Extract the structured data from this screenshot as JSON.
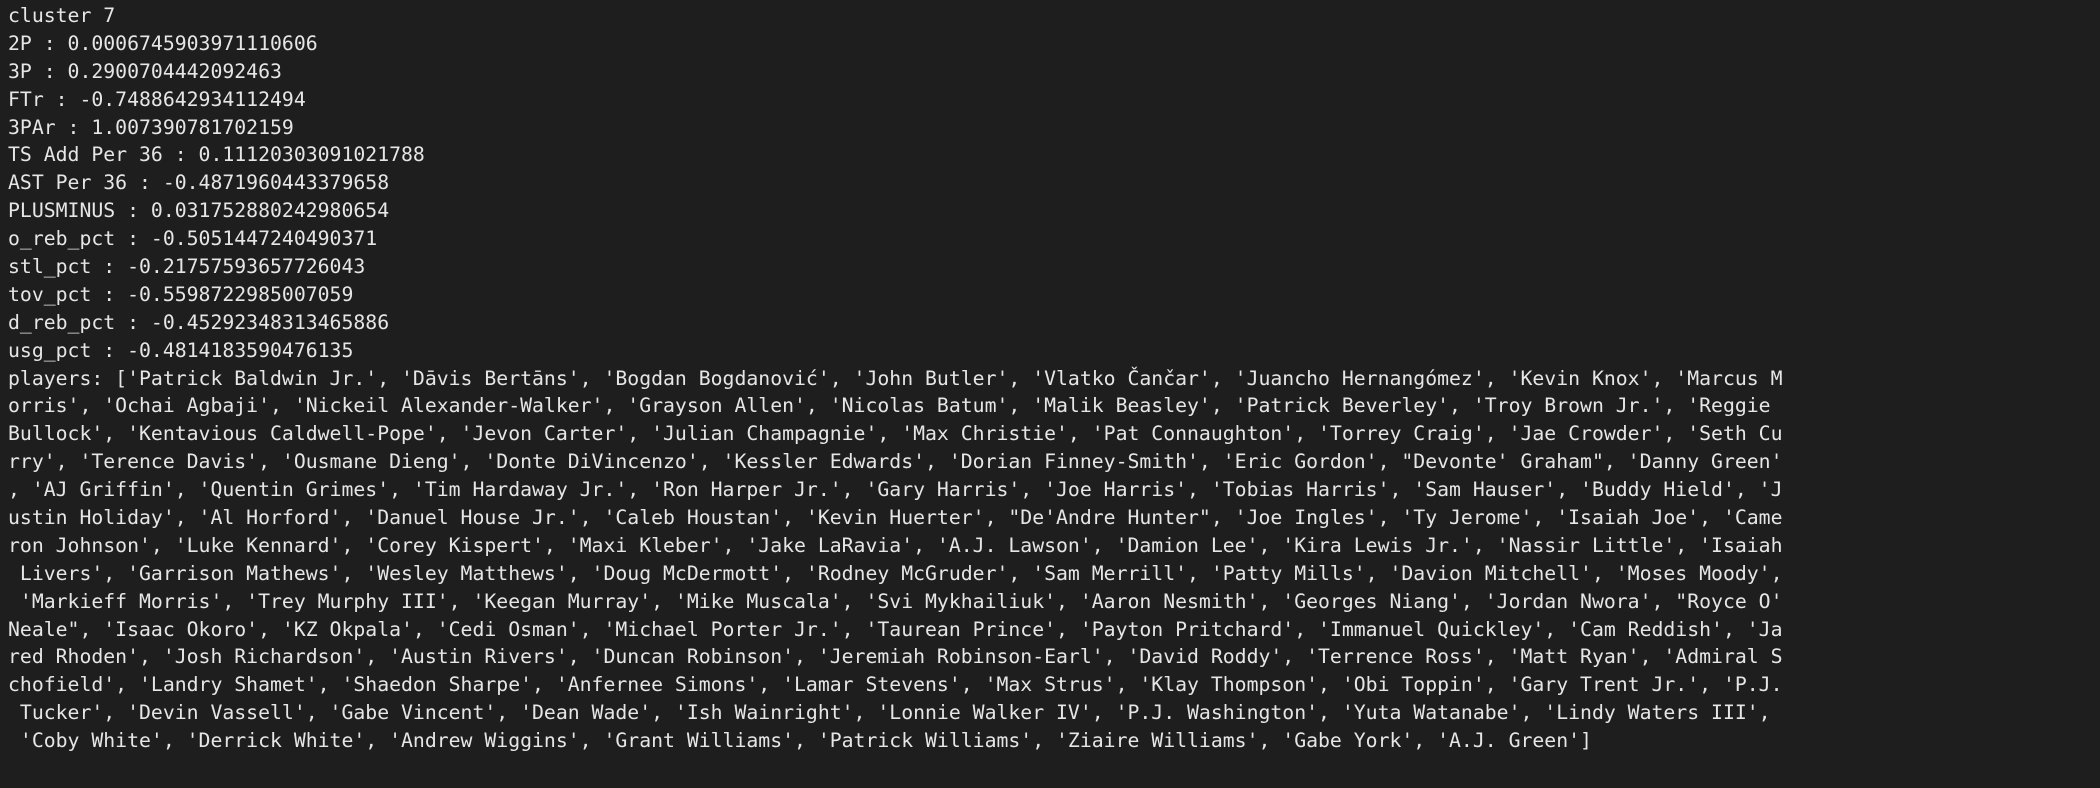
{
  "terminal": {
    "lines": [
      "cluster 7",
      "2P : 0.0006745903971110606",
      "3P : 0.2900704442092463",
      "FTr : -0.7488642934112494",
      "3PAr : 1.007390781702159",
      "TS Add Per 36 : 0.11120303091021788",
      "AST Per 36 : -0.4871960443379658",
      "PLUSMINUS : 0.031752880242980654",
      "o_reb_pct : -0.5051447240490371",
      "stl_pct : -0.21757593657726043",
      "tov_pct : -0.5598722985007059",
      "d_reb_pct : -0.45292348313465886",
      "usg_pct : -0.4814183590476135",
      "players: ['Patrick Baldwin Jr.', 'Dāvis Bertāns', 'Bogdan Bogdanović', 'John Butler', 'Vlatko Čančar', 'Juancho Hernangómez', 'Kevin Knox', 'Marcus M",
      "orris', 'Ochai Agbaji', 'Nickeil Alexander-Walker', 'Grayson Allen', 'Nicolas Batum', 'Malik Beasley', 'Patrick Beverley', 'Troy Brown Jr.', 'Reggie ",
      "Bullock', 'Kentavious Caldwell-Pope', 'Jevon Carter', 'Julian Champagnie', 'Max Christie', 'Pat Connaughton', 'Torrey Craig', 'Jae Crowder', 'Seth Cu",
      "rry', 'Terence Davis', 'Ousmane Dieng', 'Donte DiVincenzo', 'Kessler Edwards', 'Dorian Finney-Smith', 'Eric Gordon', \"Devonte' Graham\", 'Danny Green'",
      ", 'AJ Griffin', 'Quentin Grimes', 'Tim Hardaway Jr.', 'Ron Harper Jr.', 'Gary Harris', 'Joe Harris', 'Tobias Harris', 'Sam Hauser', 'Buddy Hield', 'J",
      "ustin Holiday', 'Al Horford', 'Danuel House Jr.', 'Caleb Houstan', 'Kevin Huerter', \"De'Andre Hunter\", 'Joe Ingles', 'Ty Jerome', 'Isaiah Joe', 'Came",
      "ron Johnson', 'Luke Kennard', 'Corey Kispert', 'Maxi Kleber', 'Jake LaRavia', 'A.J. Lawson', 'Damion Lee', 'Kira Lewis Jr.', 'Nassir Little', 'Isaiah",
      " Livers', 'Garrison Mathews', 'Wesley Matthews', 'Doug McDermott', 'Rodney McGruder', 'Sam Merrill', 'Patty Mills', 'Davion Mitchell', 'Moses Moody',",
      " 'Markieff Morris', 'Trey Murphy III', 'Keegan Murray', 'Mike Muscala', 'Svi Mykhailiuk', 'Aaron Nesmith', 'Georges Niang', 'Jordan Nwora', \"Royce O'",
      "Neale\", 'Isaac Okoro', 'KZ Okpala', 'Cedi Osman', 'Michael Porter Jr.', 'Taurean Prince', 'Payton Pritchard', 'Immanuel Quickley', 'Cam Reddish', 'Ja",
      "red Rhoden', 'Josh Richardson', 'Austin Rivers', 'Duncan Robinson', 'Jeremiah Robinson-Earl', 'David Roddy', 'Terrence Ross', 'Matt Ryan', 'Admiral S",
      "chofield', 'Landry Shamet', 'Shaedon Sharpe', 'Anfernee Simons', 'Lamar Stevens', 'Max Strus', 'Klay Thompson', 'Obi Toppin', 'Gary Trent Jr.', 'P.J.",
      " Tucker', 'Devin Vassell', 'Gabe Vincent', 'Dean Wade', 'Ish Wainright', 'Lonnie Walker IV', 'P.J. Washington', 'Yuta Watanabe', 'Lindy Waters III',",
      " 'Coby White', 'Derrick White', 'Andrew Wiggins', 'Grant Williams', 'Patrick Williams', 'Ziaire Williams', 'Gabe York', 'A.J. Green']"
    ]
  }
}
